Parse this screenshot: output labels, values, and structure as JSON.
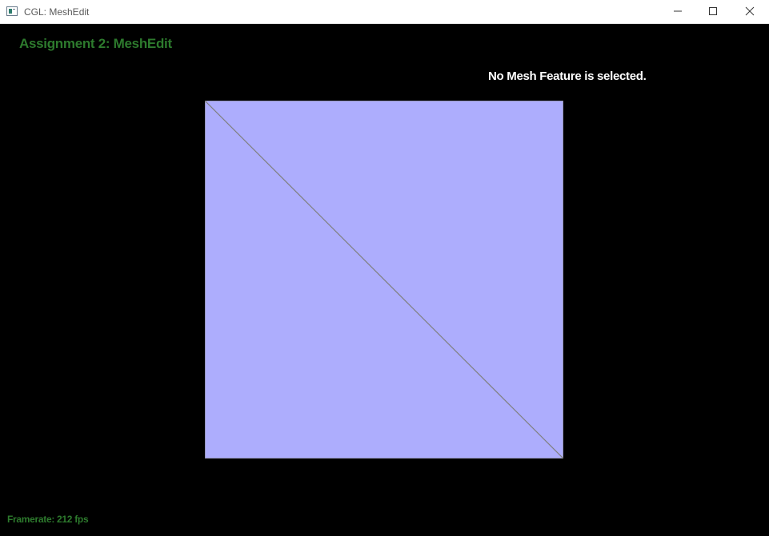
{
  "window": {
    "title": "CGL: MeshEdit",
    "controls": {
      "minimize": "minimize-icon",
      "maximize": "maximize-icon",
      "close": "close-icon"
    }
  },
  "hud": {
    "title": "Assignment 2: MeshEdit",
    "selection_info": "No Mesh Feature is selected.",
    "framerate": "Framerate: 212 fps"
  },
  "colors": {
    "background": "#000000",
    "hud_text": "#2d7a2d",
    "info_text": "#ffffff",
    "mesh_fill": "#adadfd",
    "mesh_edge": "#808080"
  },
  "mesh": {
    "faces": 2,
    "vertices": 4
  }
}
